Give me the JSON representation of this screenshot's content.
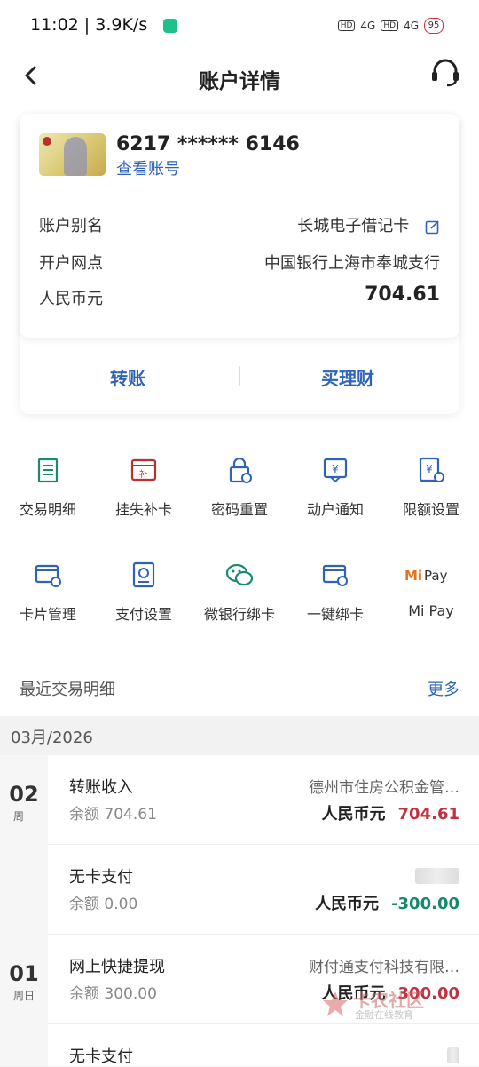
{
  "status_bar": {
    "time": "11:02",
    "speed": "3.9K/s",
    "battery": "95",
    "hd1": "HD",
    "hd2": "HD",
    "net1": "4G",
    "net2": "4G"
  },
  "nav": {
    "title": "账户详情"
  },
  "card": {
    "account_no": "6217 ****** 6146",
    "view_account": "查看账号",
    "alias_label": "账户别名",
    "alias_value": "长城电子借记卡",
    "branch_label": "开户网点",
    "branch_value": "中国银行上海市奉城支行",
    "currency_label": "人民币元",
    "balance": "704.61",
    "transfer": "转账",
    "wealth": "买理财"
  },
  "grid": [
    {
      "label": "交易明细",
      "icon": "list-icon"
    },
    {
      "label": "挂失补卡",
      "icon": "card-report-icon"
    },
    {
      "label": "密码重置",
      "icon": "lock-reset-icon"
    },
    {
      "label": "动户通知",
      "icon": "notify-icon"
    },
    {
      "label": "限额设置",
      "icon": "limit-setting-icon"
    },
    {
      "label": "卡片管理",
      "icon": "card-manage-icon"
    },
    {
      "label": "支付设置",
      "icon": "pay-setting-icon"
    },
    {
      "label": "微银行绑卡",
      "icon": "wechat-icon"
    },
    {
      "label": "一键绑卡",
      "icon": "bind-card-icon"
    },
    {
      "label": "Mi Pay",
      "icon": "mipay-icon"
    }
  ],
  "recent": {
    "title": "最近交易明细",
    "more": "更多",
    "month": "03月/2026"
  },
  "transactions": [
    {
      "day": "02",
      "weekday": "周一",
      "title": "转账收入",
      "balance": "余额 704.61",
      "counterparty": "德州市住房公积金管…",
      "currency": "人民币元",
      "amount": "704.61",
      "color": "#c2313f"
    },
    {
      "title": "无卡支付",
      "balance": "余额 0.00",
      "counterparty": "",
      "currency": "人民币元",
      "amount": "-300.00",
      "color": "#0f8a6a"
    },
    {
      "day": "01",
      "weekday": "周日",
      "title": "网上快捷提现",
      "balance": "余额 300.00",
      "counterparty": "财付通支付科技有限…",
      "currency": "人民币元",
      "amount": "300.00",
      "color": "#c2313f"
    },
    {
      "title": "无卡支付",
      "balance": "",
      "counterparty": "",
      "currency": "",
      "amount": "",
      "color": "#0f8a6a"
    }
  ],
  "watermark": {
    "title": "卡农社区",
    "subtitle": "金融在线教育"
  }
}
